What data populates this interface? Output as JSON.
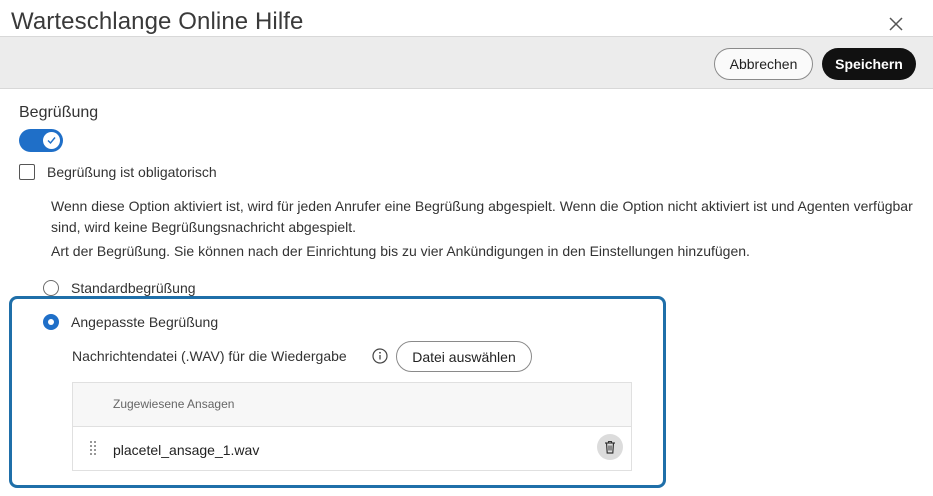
{
  "dialog": {
    "title": "Warteschlange Online Hilfe"
  },
  "toolbar": {
    "cancel_label": "Abbrechen",
    "save_label": "Speichern"
  },
  "greeting": {
    "section_label": "Begrüßung",
    "toggle_on": true,
    "mandatory_checkbox_label": "Begrüßung ist obligatorisch",
    "mandatory_checked": false,
    "description_1": "Wenn diese Option aktiviert ist, wird für jeden Anrufer eine Begrüßung abgespielt. Wenn die Option nicht aktiviert ist und Agenten verfügbar sind, wird keine Begrüßungsnachricht abgespielt.",
    "description_2": "Art der Begrüßung. Sie können nach der Einrichtung bis zu vier Ankündigungen in den Einstellungen hinzufügen.",
    "options": [
      {
        "label": "Standardbegrüßung",
        "selected": false
      },
      {
        "label": "Angepasste Begrüßung",
        "selected": true
      }
    ],
    "file_label": "Nachrichtendatei (.WAV) für die Wiedergabe",
    "choose_file_label": "Datei auswählen",
    "table": {
      "header": "Zugewiesene Ansagen",
      "rows": [
        {
          "filename": "placetel_ansage_1.wav"
        }
      ]
    }
  },
  "colors": {
    "accent": "#1f6fc8",
    "highlight_border": "#1f6fa9",
    "toolbar_bg": "#ececec",
    "save_button_bg": "#111111"
  },
  "icons": {
    "close": "close-icon",
    "toggle_check": "check-icon",
    "info": "info-icon",
    "drag": "drag-handle-icon",
    "delete": "trash-icon"
  }
}
